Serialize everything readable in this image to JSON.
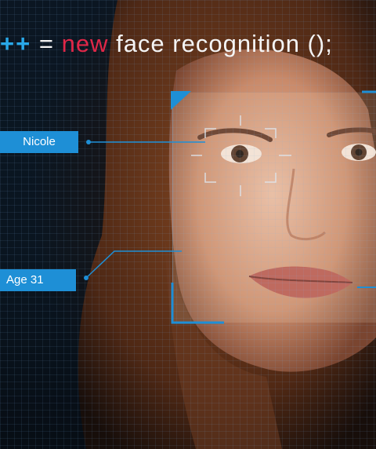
{
  "headline": {
    "operator": "++",
    "assign": "=",
    "keyword": "new",
    "call": "face recognition ();"
  },
  "labels": {
    "name": "Nicole",
    "age": "Age 31"
  },
  "colors": {
    "accent_blue": "#1e8fd6",
    "operator_blue": "#29a8e8",
    "keyword_red": "#e02748",
    "text_white": "#f4f4f4"
  }
}
